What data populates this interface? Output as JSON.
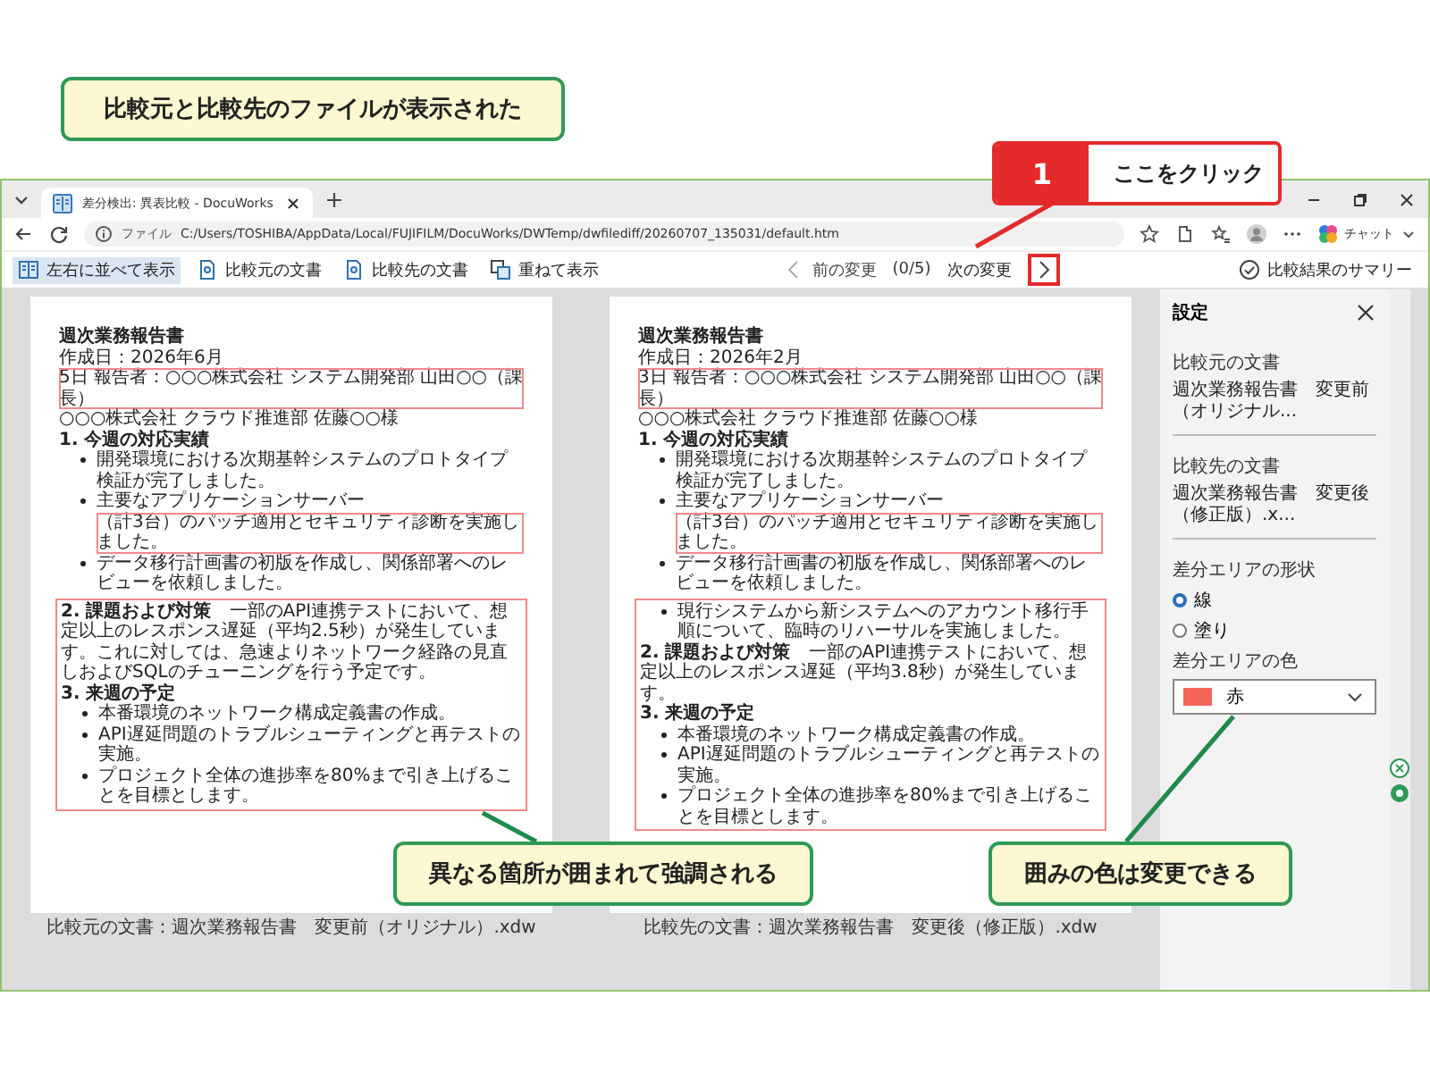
{
  "annotations": [
    {
      "kind": "banner",
      "text": "比較元と比較先のファイルが表示された"
    },
    {
      "kind": "step",
      "number": "1",
      "text": "ここをクリック"
    },
    {
      "kind": "callout",
      "text": "異なる箇所が囲まれて強調される"
    },
    {
      "kind": "callout",
      "text": "囲みの色は変更できる"
    }
  ],
  "browser": {
    "tab_title": "差分検出: 異表比較 - DocuWorks",
    "address_label": "ファイル",
    "url": "C:/Users/TOSHIBA/AppData/Local/FUJIFILM/DocuWorks/DWTemp/dwfilediff/20260707_135031/default.htm",
    "chat_label": "チャット"
  },
  "toolbar": {
    "buttons": [
      {
        "kind": "side",
        "label": "左右に並べて表示"
      },
      {
        "kind": "doc",
        "label": "比較元の文書"
      },
      {
        "kind": "doc",
        "label": "比較先の文書"
      },
      {
        "kind": "overlay",
        "label": "重ねて表示"
      }
    ],
    "prev": "前の変更",
    "count": "(0/5)",
    "next": "次の変更",
    "summary": "比較結果のサマリー"
  },
  "documents": [
    {
      "caption": "比較元の文書：週次業務報告書　変更前（オリジナル）.xdw",
      "blocks": [
        {
          "changed": false,
          "lines": [
            {
              "kind": "title",
              "segments": [
                {
                  "text": "週次業務報告書",
                  "changed": false
                }
              ]
            },
            {
              "kind": "text",
              "segments": [
                {
                  "text": "作成日：2026年6月",
                  "changed": false
                },
                {
                  "text": "5日 報告者：○○○株式会社 システム開発部 山田○○（課長）",
                  "changed": true
                }
              ]
            },
            {
              "kind": "text",
              "segments": [
                {
                  "text": "○○○株式会社 クラウド推進部 佐藤○○様",
                  "changed": false
                }
              ]
            },
            {
              "kind": "heading",
              "segments": [
                {
                  "text": "1. 今週の対応実績",
                  "changed": false
                }
              ]
            },
            {
              "kind": "bullet",
              "segments": [
                {
                  "text": "開発環境における次期基幹システムのプロトタイプ検証が完了しました。",
                  "changed": false
                }
              ]
            },
            {
              "kind": "bullet",
              "segments": [
                {
                  "text": "主要なアプリケーションサーバー",
                  "changed": false
                },
                {
                  "text": "（計3台）のパッチ適用とセキュリティ診断を実施しました。",
                  "changed": true
                }
              ]
            },
            {
              "kind": "bullet",
              "segments": [
                {
                  "text": "データ移行計画書の初版を作成し、関係部署へのレビューを依頼しました。",
                  "changed": false
                }
              ]
            }
          ]
        },
        {
          "changed": true,
          "lines": [
            {
              "kind": "text",
              "segments": [
                {
                  "text": "**2. 課題および対策**　一部のAPI連携テストにおいて、想定以上のレスポンス遅延（平均2.5秒）が発生しています。これに対しては、急速よりネットワーク経路の見直しおよびSQLのチューニングを行う予定です。",
                  "changed": false
                }
              ]
            },
            {
              "kind": "heading",
              "segments": [
                {
                  "text": "3. 来週の予定",
                  "changed": false
                }
              ]
            },
            {
              "kind": "bullet",
              "segments": [
                {
                  "text": "本番環境のネットワーク構成定義書の作成。",
                  "changed": false
                }
              ]
            },
            {
              "kind": "bullet",
              "segments": [
                {
                  "text": "API遅延問題のトラブルシューティングと再テストの実施。",
                  "changed": false
                }
              ]
            },
            {
              "kind": "bullet",
              "segments": [
                {
                  "text": "プロジェクト全体の進捗率を80%まで引き上げることを目標とします。",
                  "changed": false
                }
              ]
            }
          ]
        }
      ]
    },
    {
      "caption": "比較先の文書：週次業務報告書　変更後（修正版）.xdw",
      "blocks": [
        {
          "changed": false,
          "lines": [
            {
              "kind": "title",
              "segments": [
                {
                  "text": "週次業務報告書",
                  "changed": false
                }
              ]
            },
            {
              "kind": "text",
              "segments": [
                {
                  "text": "作成日：2026年2月",
                  "changed": false
                },
                {
                  "text": "3日 報告者：○○○株式会社 システム開発部 山田○○（課長）",
                  "changed": true
                }
              ]
            },
            {
              "kind": "text",
              "segments": [
                {
                  "text": "○○○株式会社 クラウド推進部 佐藤○○様",
                  "changed": false
                }
              ]
            },
            {
              "kind": "heading",
              "segments": [
                {
                  "text": "1. 今週の対応実績",
                  "changed": false
                }
              ]
            },
            {
              "kind": "bullet",
              "segments": [
                {
                  "text": "開発環境における次期基幹システムのプロトタイプ検証が完了しました。",
                  "changed": false
                }
              ]
            },
            {
              "kind": "bullet",
              "segments": [
                {
                  "text": "主要なアプリケーションサーバー",
                  "changed": false
                },
                {
                  "text": "（計3台）のパッチ適用とセキュリティ診断を実施しました。",
                  "changed": true
                }
              ]
            },
            {
              "kind": "bullet",
              "segments": [
                {
                  "text": "データ移行計画書の初版を作成し、関係部署へのレビューを依頼しました。",
                  "changed": false
                }
              ]
            }
          ]
        },
        {
          "changed": true,
          "lines": [
            {
              "kind": "bullet",
              "segments": [
                {
                  "text": "現行システムから新システムへのアカウント移行手順について、臨時のリハーサルを実施しました。",
                  "changed": false
                }
              ]
            },
            {
              "kind": "text",
              "segments": [
                {
                  "text": "**2. 課題および対策**　一部のAPI連携テストにおいて、想定以上のレスポンス遅延（平均3.8秒）が発生しています。",
                  "changed": false
                }
              ]
            },
            {
              "kind": "heading",
              "segments": [
                {
                  "text": "3. 来週の予定",
                  "changed": false
                }
              ]
            },
            {
              "kind": "bullet",
              "segments": [
                {
                  "text": "本番環境のネットワーク構成定義書の作成。",
                  "changed": false
                }
              ]
            },
            {
              "kind": "bullet",
              "segments": [
                {
                  "text": "API遅延問題のトラブルシューティングと再テストの実施。",
                  "changed": false
                }
              ]
            },
            {
              "kind": "bullet",
              "segments": [
                {
                  "text": "プロジェクト全体の進捗率を80%まで引き上げることを目標とします。",
                  "changed": false
                }
              ]
            }
          ]
        }
      ]
    }
  ],
  "settings": {
    "title": "設定",
    "source_label": "比較元の文書",
    "source_value": "週次業務報告書　変更前（オリジナル...",
    "target_label": "比較先の文書",
    "target_value": "週次業務報告書　変更後（修正版）.x...",
    "shape_label": "差分エリアの形状",
    "shapes": [
      {
        "label": "線",
        "selected": true
      },
      {
        "label": "塗り",
        "selected": false
      }
    ],
    "color_label": "差分エリアの色",
    "color_value": "赤",
    "color": "#f4655a"
  }
}
